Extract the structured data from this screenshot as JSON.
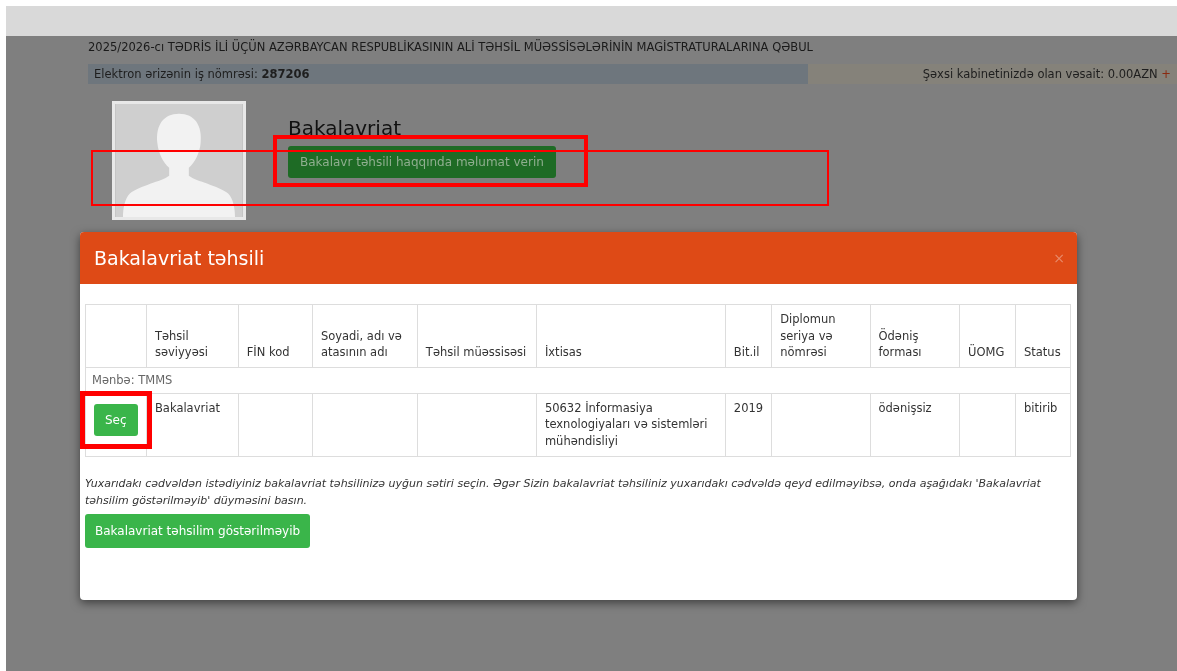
{
  "page_title": "2025/2026-cı TƏDRİS İLİ ÜÇÜN AZƏRBAYCAN RESPUBLİKASININ ALİ TƏHSİL MÜƏSSİSƏLƏRİNİN MAGİSTRATURALARINA QƏBUL",
  "info_bar": {
    "label": "Elektron ərizənin iş nömrəsi: ",
    "number": "287206",
    "balance": "Şəxsi kabinetinizdə olan vəsait: 0.00AZN",
    "add": "+"
  },
  "profile": {
    "heading": "Bakalavriat",
    "button": {
      "label": "Bakalavr təhsili haqqında məlumat verin",
      "highlighted": true
    },
    "section_highlighted": true
  },
  "modal": {
    "title": "Bakalavriat təhsili",
    "close": "×",
    "table": {
      "columns": [
        "",
        "Təhsil səviyyəsi",
        "FİN kod",
        "Soyadi, adı və atasının adı",
        "Təhsil müəssisəsi",
        "İxtisas",
        "Bit.il",
        "Diplomun seriya və nömrəsi",
        "Ödəniş forması",
        "ÜOMG",
        "Status"
      ],
      "group": "Mənbə: TMMS",
      "rows": [
        {
          "highlighted": true,
          "cells": [
            "Seç",
            "Bakalavriat",
            "",
            "",
            "",
            "50632 İnformasiya texnologiyaları və sistemləri mühəndisliyi",
            "2019",
            "",
            "ödənişsiz",
            "",
            "bitirib"
          ]
        }
      ]
    },
    "note": "Yuxarıdakı cədvəldən istədiyiniz bakalavriat təhsilinizə uyğun sətiri seçin. Əgər Sizin bakalavriat təhsiliniz yuxarıdakı cədvəldə qeyd edilməyibsə, onda aşağıdakı 'Bakalavriat təhsilim göstərilməyib' düyməsini basın.",
    "footer_button": "Bakalavriat təhsilim göstərilməyib"
  }
}
